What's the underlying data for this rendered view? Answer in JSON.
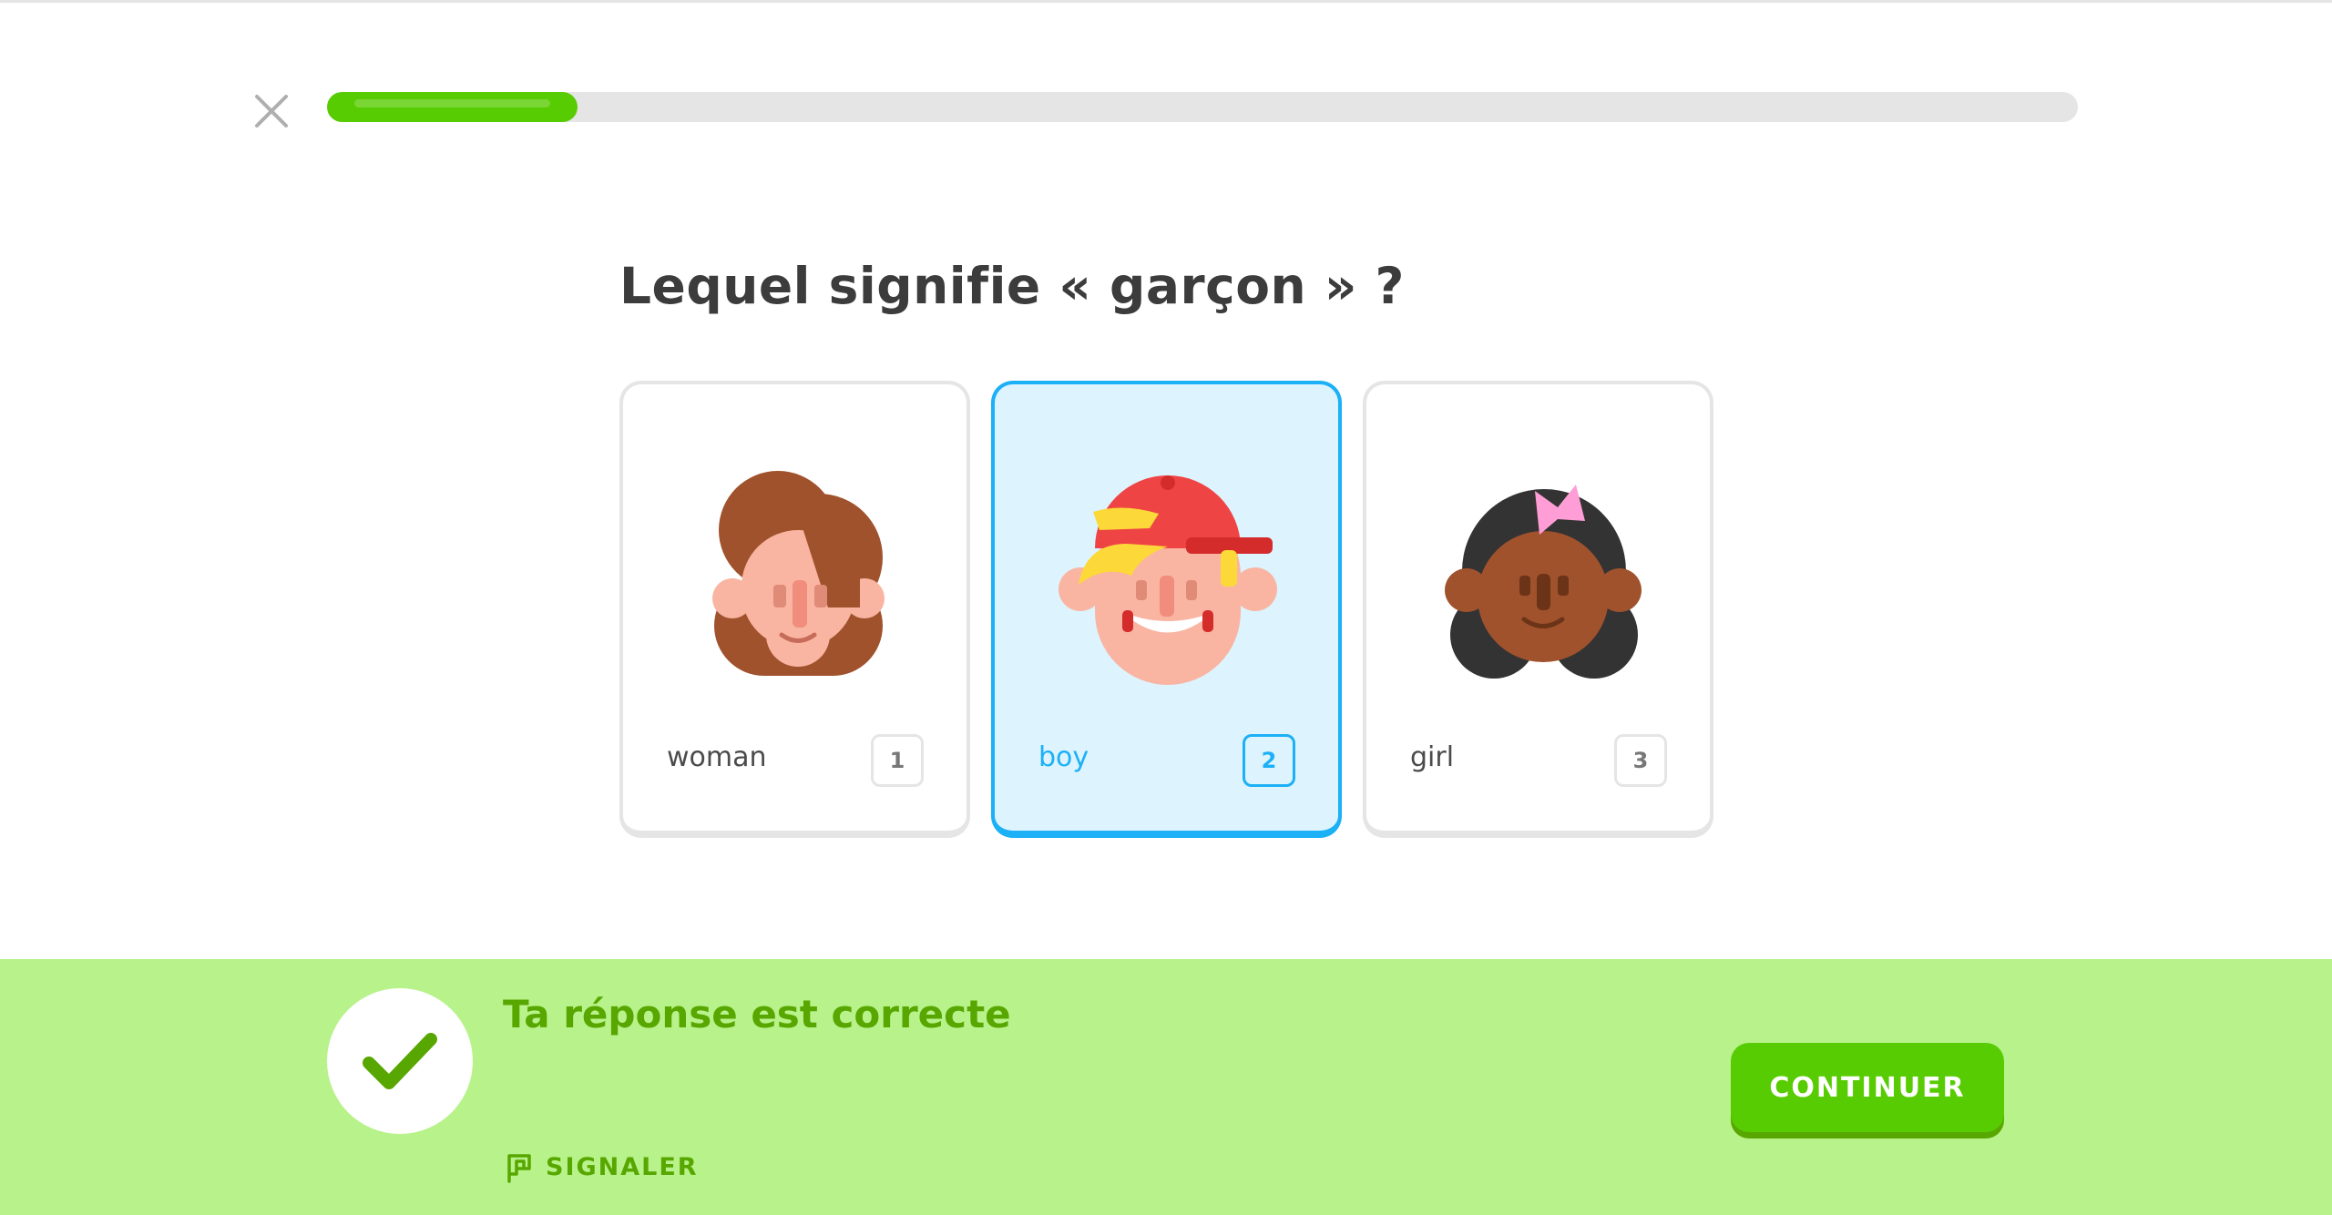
{
  "progress": {
    "fraction": 0.143
  },
  "icons": {
    "close": "close-icon",
    "check": "check-icon",
    "report": "flag-icon"
  },
  "question": {
    "text": "Lequel signifie « garçon » ?"
  },
  "choices": [
    {
      "label": "woman",
      "key": "1",
      "icon": "woman-face-icon",
      "selected": false
    },
    {
      "label": "boy",
      "key": "2",
      "icon": "boy-face-icon",
      "selected": true
    },
    {
      "label": "girl",
      "key": "3",
      "icon": "girl-face-icon",
      "selected": false
    }
  ],
  "feedback": {
    "title": "Ta réponse est correcte",
    "report_label": "SIGNALER",
    "continue_label": "CONTINUER"
  },
  "colors": {
    "primary_green": "#58cc02",
    "dark_green": "#58a700",
    "footer_bg": "#b8f28b",
    "selected_blue": "#1cb0f6",
    "selected_bg": "#ddf4ff"
  }
}
